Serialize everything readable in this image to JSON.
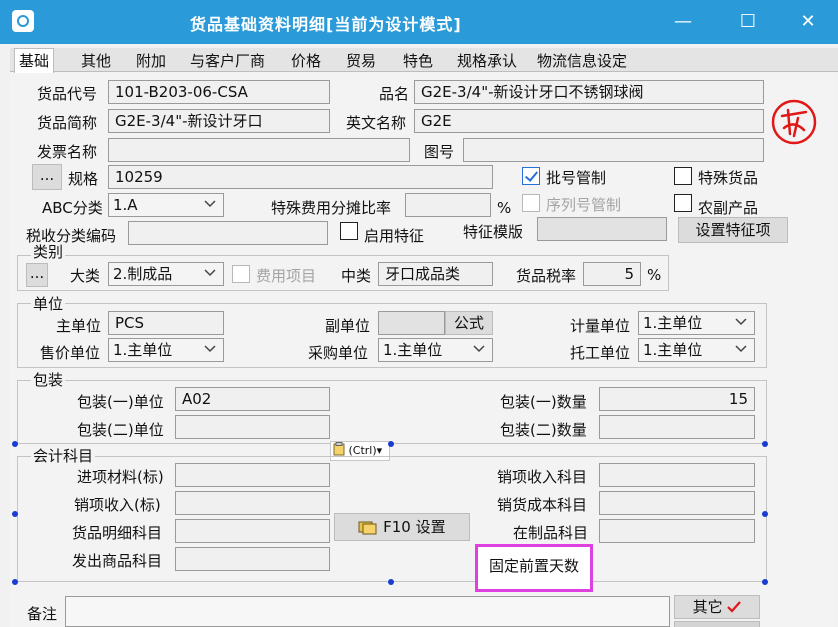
{
  "window": {
    "title": "货品基础资料明细[当前为设计模式]",
    "minimize_glyph": "—",
    "maximize_glyph": "☐",
    "close_glyph": "✕"
  },
  "tabs": [
    "基础",
    "其他",
    "附加",
    "与客户厂商",
    "价格",
    "贸易",
    "特色",
    "规格承认",
    "物流信息设定"
  ],
  "basic": {
    "item_code_label": "货品代号",
    "item_code": "101-B203-06-CSA",
    "item_name_label": "品名",
    "item_name": "G2E-3/4\"-新设计牙口不锈钢球阀",
    "short_name_label": "货品简称",
    "short_name": "G2E-3/4\"-新设计牙口",
    "english_name_label": "英文名称",
    "english_name": "G2E",
    "invoice_name_label": "发票名称",
    "invoice_name": "",
    "drawing_no_label": "图号",
    "drawing_no": "",
    "browse_label": "...",
    "spec_label": "规格",
    "spec": "10259",
    "batch_control_label": "批号管制",
    "batch_control": true,
    "special_item_label": "特殊货品",
    "special_item": false,
    "abc_label": "ABC分类",
    "abc": "1.A",
    "special_fee_label": "特殊费用分摊比率",
    "special_fee": "",
    "percent_sign": "%",
    "serial_control_label": "序列号管制",
    "serial_control": false,
    "agri_label": "农副产品",
    "agri": false,
    "tax_code_label": "税收分类编码",
    "tax_code": "",
    "enable_feature_label": "启用特征",
    "enable_feature": false,
    "feature_template_label": "特征模版",
    "feature_template": "",
    "set_feature_button": "设置特征项"
  },
  "category": {
    "group_label": "类别",
    "browse_label": "...",
    "major_label": "大类",
    "major": "2.制成品",
    "expense_item_label": "费用项目",
    "expense_item": false,
    "middle_label": "中类",
    "middle": "牙口成品类",
    "tax_rate_label": "货品税率",
    "tax_rate": "5",
    "percent_sign": "%"
  },
  "units": {
    "group_label": "单位",
    "main_label": "主单位",
    "main": "PCS",
    "sub_label": "副单位",
    "sub": "",
    "formula_button": "公式",
    "measure_label": "计量单位",
    "measure": "1.主单位",
    "sale_label": "售价单位",
    "sale": "1.主单位",
    "purchase_label": "采购单位",
    "purchase": "1.主单位",
    "outsource_label": "托工单位",
    "outsource": "1.主单位"
  },
  "packaging": {
    "group_label": "包装",
    "pack1_unit_label": "包装(一)单位",
    "pack1_unit": "A02",
    "pack1_qty_label": "包装(一)数量",
    "pack1_qty": "15",
    "pack2_unit_label": "包装(二)单位",
    "pack2_unit": "",
    "pack2_qty_label": "包装(二)数量",
    "pack2_qty": ""
  },
  "paste_tooltip": "(Ctrl)▾",
  "accounting": {
    "group_label": "会计科目",
    "input_material_label": "进项材料(标)",
    "input_material": "",
    "sales_income_label": "销项收入科目",
    "sales_income": "",
    "sales_income_std_label": "销项收入(标)",
    "sales_income_std": "",
    "sales_cost_label": "销货成本科目",
    "sales_cost": "",
    "item_detail_label": "货品明细科目",
    "item_detail": "",
    "wip_label": "在制品科目",
    "wip": "",
    "shipped_goods_label": "发出商品科目",
    "shipped_goods": "",
    "f10_button": "F10 设置",
    "fixed_lead_days_label": "固定前置天数"
  },
  "remarks_label": "备注",
  "remarks": "",
  "other_button": "其它",
  "colors": {
    "titlebar": "#2a9ad8",
    "highlight_border": "#e040e0",
    "selection_dot": "#1a3ccf",
    "seal": "#e01818"
  }
}
